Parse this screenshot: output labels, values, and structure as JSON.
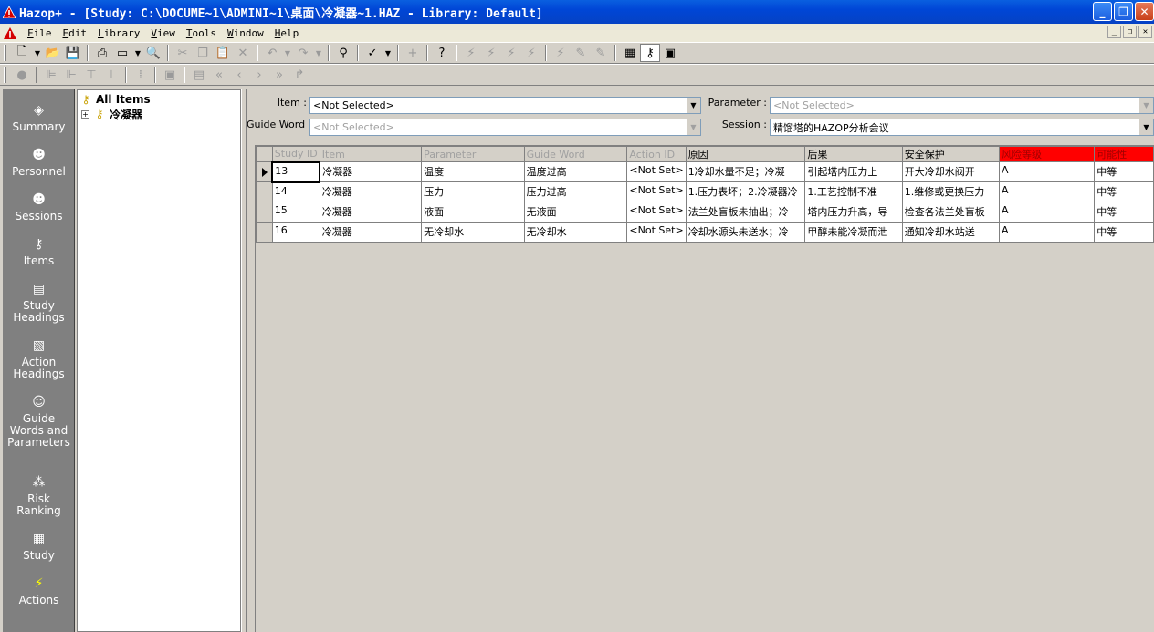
{
  "window": {
    "title": "Hazop+ - [Study: C:\\DOCUME~1\\ADMINI~1\\桌面\\冷凝器~1.HAZ - Library: Default]",
    "buttons": {
      "minimize": "_",
      "restore": "❐",
      "close": "✕"
    }
  },
  "menu": {
    "items": [
      {
        "u": "F",
        "rest": "ile"
      },
      {
        "u": "E",
        "rest": "dit"
      },
      {
        "u": "L",
        "rest": "ibrary"
      },
      {
        "u": "V",
        "rest": "iew"
      },
      {
        "u": "T",
        "rest": "ools"
      },
      {
        "u": "W",
        "rest": "indow"
      },
      {
        "u": "H",
        "rest": "elp"
      }
    ],
    "mdi": {
      "minimize": "_",
      "restore": "❐",
      "close": "✕"
    }
  },
  "nav": {
    "items": [
      {
        "label1": "Summary",
        "label2": "",
        "label3": "",
        "icon": "summary-icon",
        "glyph": "◈"
      },
      {
        "label1": "Personnel",
        "label2": "",
        "label3": "",
        "icon": "person-icon",
        "glyph": "☻"
      },
      {
        "label1": "Sessions",
        "label2": "",
        "label3": "",
        "icon": "sessions-icon",
        "glyph": "☻"
      },
      {
        "label1": "Items",
        "label2": "",
        "label3": "",
        "icon": "key-icon",
        "glyph": "⚷"
      },
      {
        "label1": "Study",
        "label2": "Headings",
        "label3": "",
        "icon": "headings-icon",
        "glyph": "▤"
      },
      {
        "label1": "Action",
        "label2": "Headings",
        "label3": "",
        "icon": "action-headings-icon",
        "glyph": "▧"
      },
      {
        "label1": "Guide",
        "label2": "Words and",
        "label3": "Parameters",
        "icon": "guide-words-icon",
        "glyph": "☺"
      },
      {
        "label1": "Risk",
        "label2": "Ranking",
        "label3": "",
        "icon": "risk-icon",
        "glyph": "⁂"
      },
      {
        "label1": "Study",
        "label2": "",
        "label3": "",
        "icon": "study-icon",
        "glyph": "▦"
      },
      {
        "label1": "Actions",
        "label2": "",
        "label3": "",
        "icon": "lightning-icon",
        "glyph": "⚡"
      }
    ]
  },
  "tree": {
    "root": "All Items",
    "child": "冷凝器",
    "expander": "+"
  },
  "filters": {
    "item_label": "Item :",
    "item_value": "<Not Selected>",
    "guide_word_label": "Guide Word :",
    "guide_word_value": "<Not Selected>",
    "parameter_label": "Parameter :",
    "parameter_value": "<Not Selected>",
    "session_label": "Session :",
    "session_value": "精馏塔的HAZOP分析会议"
  },
  "table": {
    "columns": [
      "Study ID",
      "Item",
      "Parameter",
      "Guide Word",
      "Action ID",
      "原因",
      "后果",
      "安全保护",
      "风险等级",
      "可能性"
    ],
    "rows": [
      [
        "13",
        "冷凝器",
        "温度",
        "温度过高",
        "<Not Set>",
        " 1冷却水量不足；冷凝",
        "引起塔内压力上",
        "开大冷却水阀开",
        "A",
        "中等"
      ],
      [
        "14",
        "冷凝器",
        "压力",
        "压力过高",
        "<Not Set>",
        "1.压力表坏；2.冷凝器冷",
        "1.工艺控制不准",
        "1.维修或更换压力",
        "A",
        "中等"
      ],
      [
        "15",
        "冷凝器",
        "液面",
        "无液面",
        "<Not Set>",
        "法兰处盲板未抽出；冷",
        "塔内压力升高，导",
        "检查各法兰处盲板",
        "A",
        "中等"
      ],
      [
        "16",
        "冷凝器",
        "无冷却水",
        "无冷却水",
        "<Not Set>",
        "冷却水源头未送水；冷",
        "甲醇未能冷凝而泄",
        "通知冷却水站送",
        "A",
        "中等"
      ]
    ]
  },
  "colors": {
    "titlebar": "#0046d6",
    "risk_header": "#ff0000",
    "nav_bg": "#808080"
  }
}
